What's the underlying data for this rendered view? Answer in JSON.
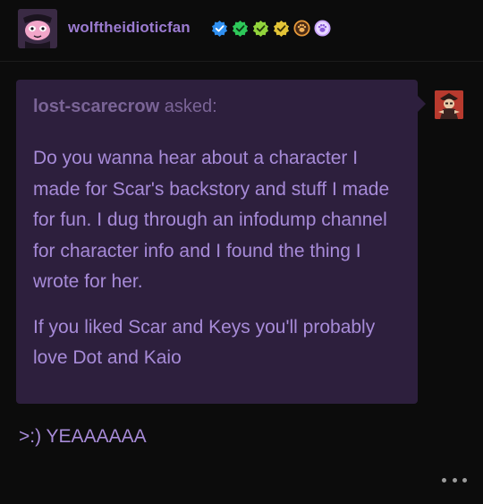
{
  "colors": {
    "background": "#0c0c0c",
    "accent_purple": "#9b7bd0",
    "ask_bubble": "#2d1f3d",
    "ask_text": "#a78bd8",
    "asker_meta": "#7a6496",
    "answer_text": "#a78bd8",
    "badge_blue": "#2f8ff0",
    "badge_green": "#2ec85a",
    "badge_lime": "#92d43c",
    "badge_yellow": "#e3c437",
    "badge_paw": "#e89a3a",
    "badge_paw2": "#c9a3ff"
  },
  "header": {
    "username": "wolftheidioticfan",
    "avatar_icon": "pink-creature-avatar",
    "badges": [
      "verified-blue-icon",
      "check-green-icon",
      "check-lime-icon",
      "check-yellow-icon",
      "paw-orange-icon",
      "paw-purple-icon"
    ]
  },
  "ask": {
    "asker": "lost-scarecrow",
    "asked_suffix": " asked:",
    "paragraphs": [
      "Do you wanna hear about a character I made for Scar's backstory and stuff I made for fun. I dug through an infodump channel for character info and I found the thing I wrote for her.",
      "If you liked Scar and Keys you'll probably love Dot and Kaio"
    ],
    "asker_avatar_icon": "scarecrow-avatar"
  },
  "answer": {
    "text": ">:) YEAAAAAA"
  },
  "more_icon": "more-options-icon"
}
